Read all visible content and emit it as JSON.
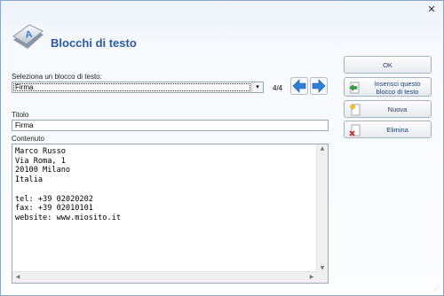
{
  "window": {
    "close_symbol": "✕",
    "close_icon": "close-icon"
  },
  "header": {
    "title": "Blocchi di testo",
    "icon": "keyboard-key-a-icon"
  },
  "select_block": {
    "label": "Seleziona un blocco di testo:",
    "value": "Firma",
    "counter": "4/4",
    "prev_icon": "arrow-left-icon",
    "next_icon": "arrow-right-icon"
  },
  "title_field": {
    "label": "Titolo",
    "value": "Firma"
  },
  "content_field": {
    "label": "Contenuto",
    "value": "Marco Russo\nVia Roma, 1\n20100 Milano\nItalia\n\ntel: +39 02020202\nfax: +39 02010101\nwebsite: www.miosito.it"
  },
  "buttons": {
    "ok": "OK",
    "insert_line1": "Inserisci questo",
    "insert_line2": "blocco di testo",
    "new": "Nuova",
    "delete": "Elimina"
  },
  "colors": {
    "accent_blue": "#2b5aa0",
    "arrow_blue": "#2f7fd6"
  }
}
